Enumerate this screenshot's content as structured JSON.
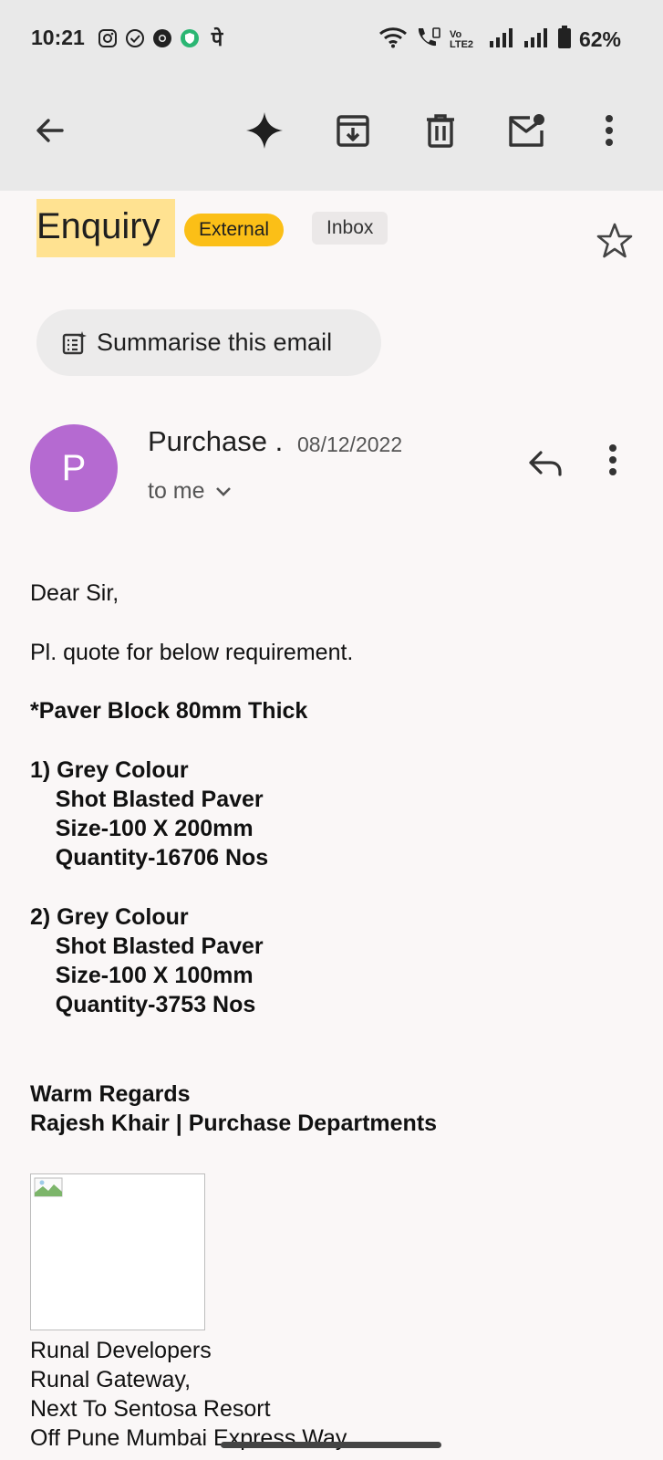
{
  "status_bar": {
    "time": "10:21",
    "battery": "62%",
    "left_icons": [
      "instagram-icon",
      "check-circle-icon",
      "chrome-icon",
      "vpn-shield-icon",
      "phonepe-icon"
    ],
    "right_icons": [
      "wifi-icon",
      "wifi-call-icon",
      "volte-icon",
      "signal-icon",
      "signal-icon-2",
      "battery-icon"
    ]
  },
  "toolbar": {
    "icons": [
      "back-arrow-icon",
      "gemini-sparkle-icon",
      "archive-icon",
      "delete-icon",
      "mark-unread-icon",
      "more-vertical-icon"
    ]
  },
  "subject": {
    "title": "Enquiry",
    "label_external": "External",
    "label_inbox": "Inbox"
  },
  "summarise": {
    "label": "Summarise this email"
  },
  "message": {
    "avatar_letter": "P",
    "sender": "Purchase .",
    "date": "08/12/2022",
    "recipient": "to me"
  },
  "body_lines": [
    "Dear Sir,",
    "Pl. quote for below requirement.",
    "*Paver Block 80mm Thick",
    "1) Grey Colour",
    "    Shot Blasted Paver",
    "    Size-100 X 200mm",
    "    Quantity-16706 Nos",
    "2) Grey Colour",
    "    Shot Blasted Paver",
    "    Size-100 X 100mm",
    "    Quantity-3753 Nos",
    "Warm Regards",
    "Rajesh Khair | Purchase Departments"
  ],
  "address_lines": [
    "Runal Developers",
    "Runal Gateway,",
    "Next To Sentosa Resort",
    "Off Pune Mumbai Express Way"
  ],
  "colors": {
    "toolbar_bg": "#e9e9e9",
    "page_bg": "#faf7f7",
    "avatar": "#b56ad1",
    "external_badge": "#fbbf17",
    "subject_highlight": "#ffe291"
  }
}
